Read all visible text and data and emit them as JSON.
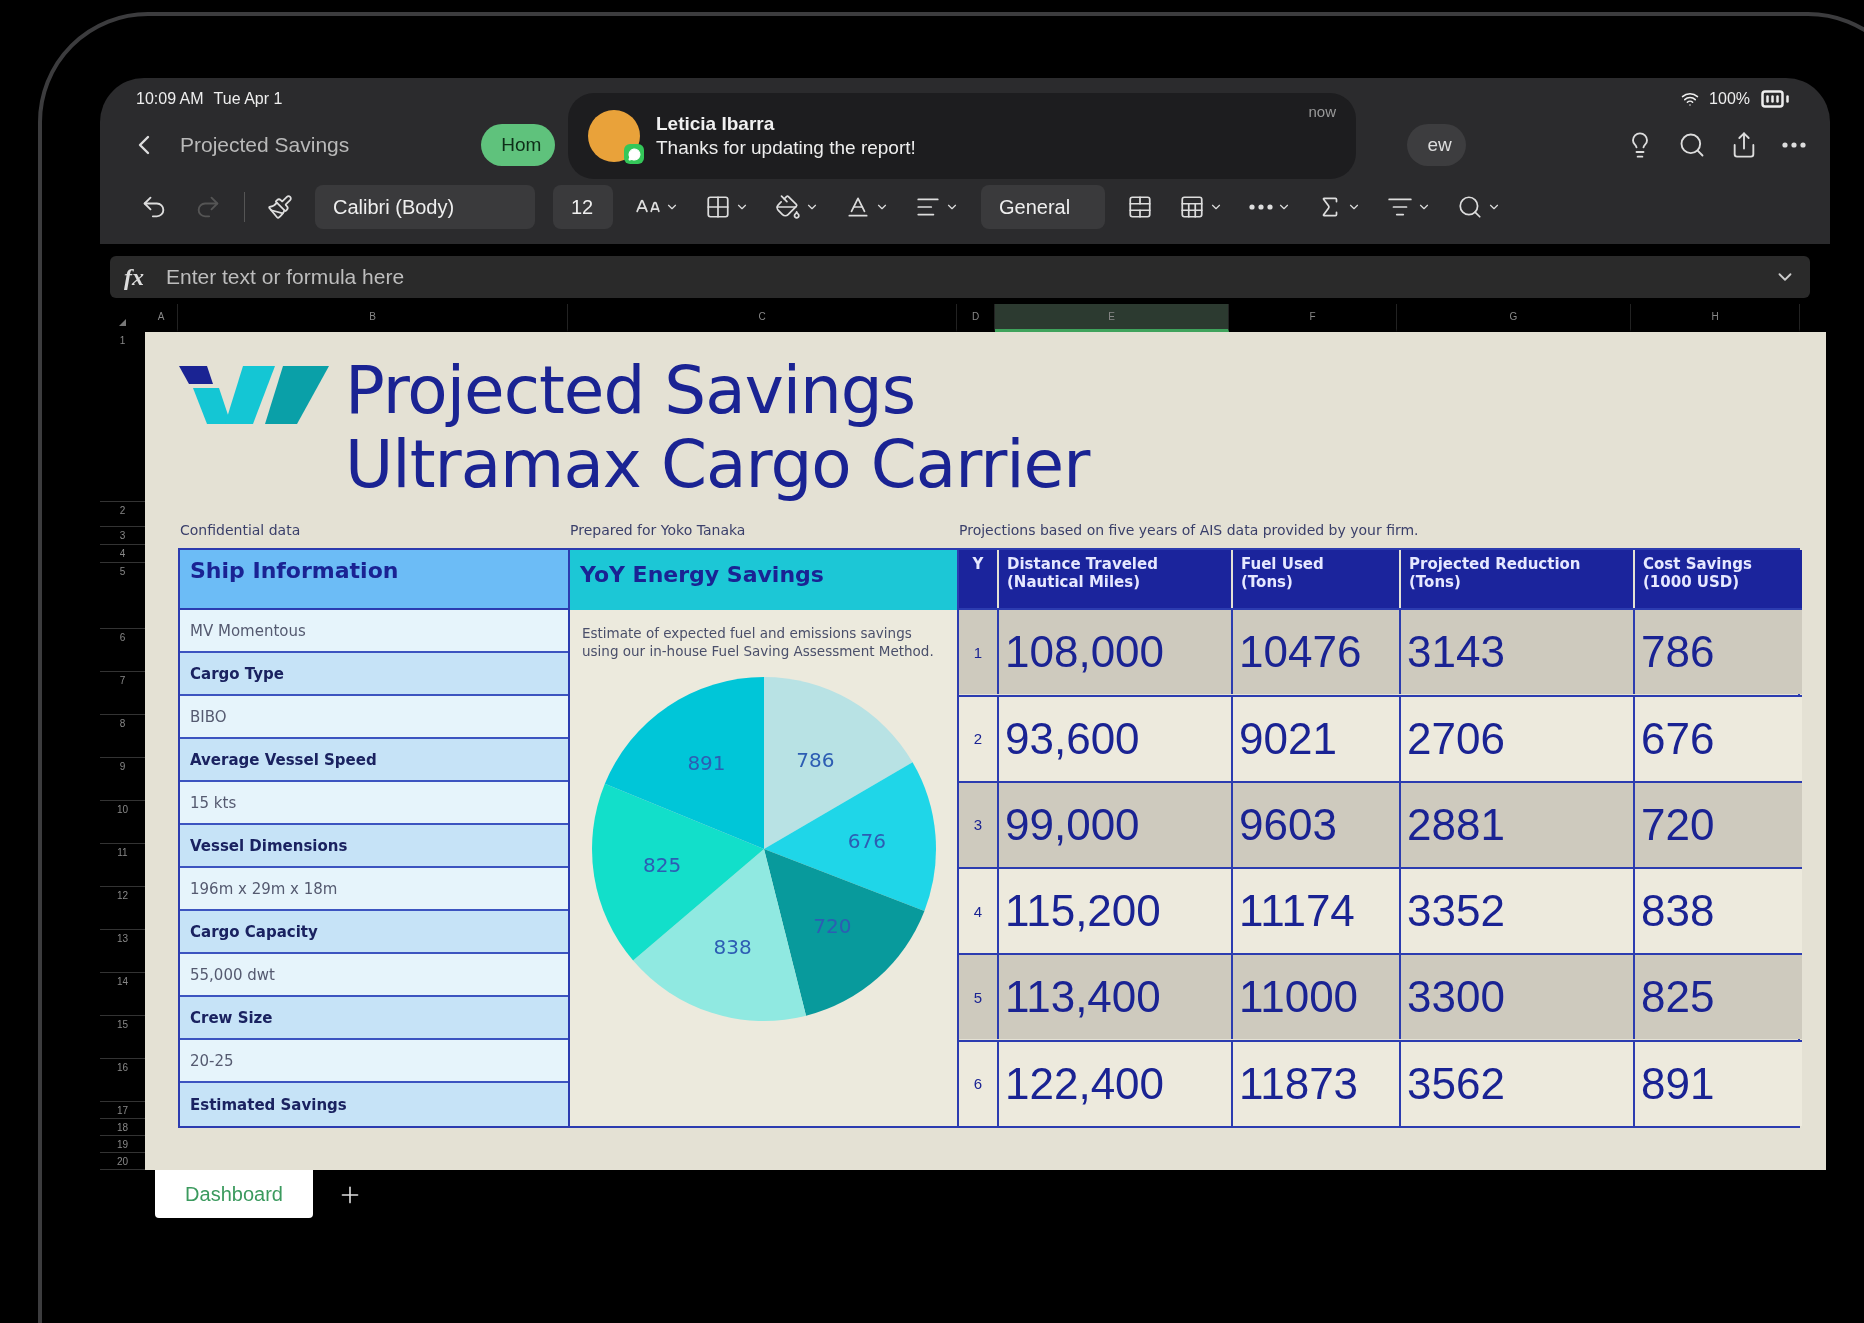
{
  "status_bar": {
    "time": "10:09 AM",
    "date": "Tue Apr 1",
    "battery": "100%"
  },
  "nav": {
    "title": "Projected Savings",
    "tabs": [
      {
        "label": "Hom",
        "selected": true
      },
      {
        "label": "ew",
        "selected": false
      }
    ]
  },
  "notification": {
    "sender": "Leticia Ibarra",
    "message": "Thanks for updating the report!",
    "time": "now"
  },
  "toolbar": {
    "redo_disabled": true,
    "font": "Calibri (Body)",
    "size": "12",
    "number_format": "General"
  },
  "formula_bar": {
    "label": "fx",
    "placeholder": "Enter text or formula here"
  },
  "column_headers": [
    {
      "label": "A",
      "selected": false
    },
    {
      "label": "B",
      "selected": false
    },
    {
      "label": "C",
      "selected": false
    },
    {
      "label": "D",
      "selected": false
    },
    {
      "label": "E",
      "selected": true
    },
    {
      "label": "F",
      "selected": false
    },
    {
      "label": "G",
      "selected": false
    },
    {
      "label": "H",
      "selected": false
    }
  ],
  "row_headers": [
    "1",
    "2",
    "3",
    "4",
    "5",
    "6",
    "7",
    "8",
    "9",
    "10",
    "11",
    "12",
    "13",
    "14",
    "15",
    "16",
    "17",
    "18",
    "19",
    "20"
  ],
  "sheet": {
    "title_lines": [
      "Projected Savings",
      "Ultramax Cargo Carrier"
    ],
    "notes": [
      "Confidential data",
      "Prepared for Yoko Tanaka",
      "Projections based on five years of AIS data provided by your firm."
    ],
    "ship_info": {
      "title": "Ship Information",
      "rows": [
        {
          "kind": "value",
          "text": "MV Momentous"
        },
        {
          "kind": "label",
          "text": "Cargo Type"
        },
        {
          "kind": "value",
          "text": "BIBO"
        },
        {
          "kind": "label",
          "text": "Average Vessel Speed"
        },
        {
          "kind": "value",
          "text": "15 kts"
        },
        {
          "kind": "label",
          "text": "Vessel Dimensions"
        },
        {
          "kind": "value",
          "text": "196m x 29m x 18m"
        },
        {
          "kind": "label",
          "text": "Cargo Capacity"
        },
        {
          "kind": "value",
          "text": "55,000 dwt"
        },
        {
          "kind": "label",
          "text": "Crew Size"
        },
        {
          "kind": "value",
          "text": "20-25"
        },
        {
          "kind": "label",
          "text": "Estimated Savings"
        }
      ]
    },
    "energy": {
      "title": "YoY Energy Savings",
      "description": "Estimate of expected fuel and emissions savings using our in-house Fuel Saving Assessment Method.",
      "chart_data": {
        "type": "pie",
        "values": [
          786,
          676,
          720,
          838,
          825,
          891
        ],
        "data_labels": true
      }
    },
    "projections": {
      "columns": [
        [
          "Y"
        ],
        [
          "Distance Traveled",
          "(Nautical Miles)"
        ],
        [
          "Fuel Used",
          "(Tons)"
        ],
        [
          "Projected Reduction",
          "(Tons)"
        ],
        [
          "Cost Savings",
          "(1000 USD)"
        ]
      ],
      "rows": [
        {
          "year": "1",
          "values": [
            "108,000",
            "10476",
            "3143",
            "786"
          ]
        },
        {
          "year": "2",
          "values": [
            "93,600",
            "9021",
            "2706",
            "676"
          ]
        },
        {
          "year": "3",
          "values": [
            "99,000",
            "9603",
            "2881",
            "720"
          ]
        },
        {
          "year": "4",
          "values": [
            "115,200",
            "11174",
            "3352",
            "838"
          ]
        },
        {
          "year": "5",
          "values": [
            "113,400",
            "11000",
            "3300",
            "825"
          ]
        },
        {
          "year": "6",
          "values": [
            "122,400",
            "11873",
            "3562",
            "891"
          ]
        }
      ]
    }
  },
  "sheet_tabs": [
    {
      "label": "Dashboard",
      "selected": true
    }
  ]
}
